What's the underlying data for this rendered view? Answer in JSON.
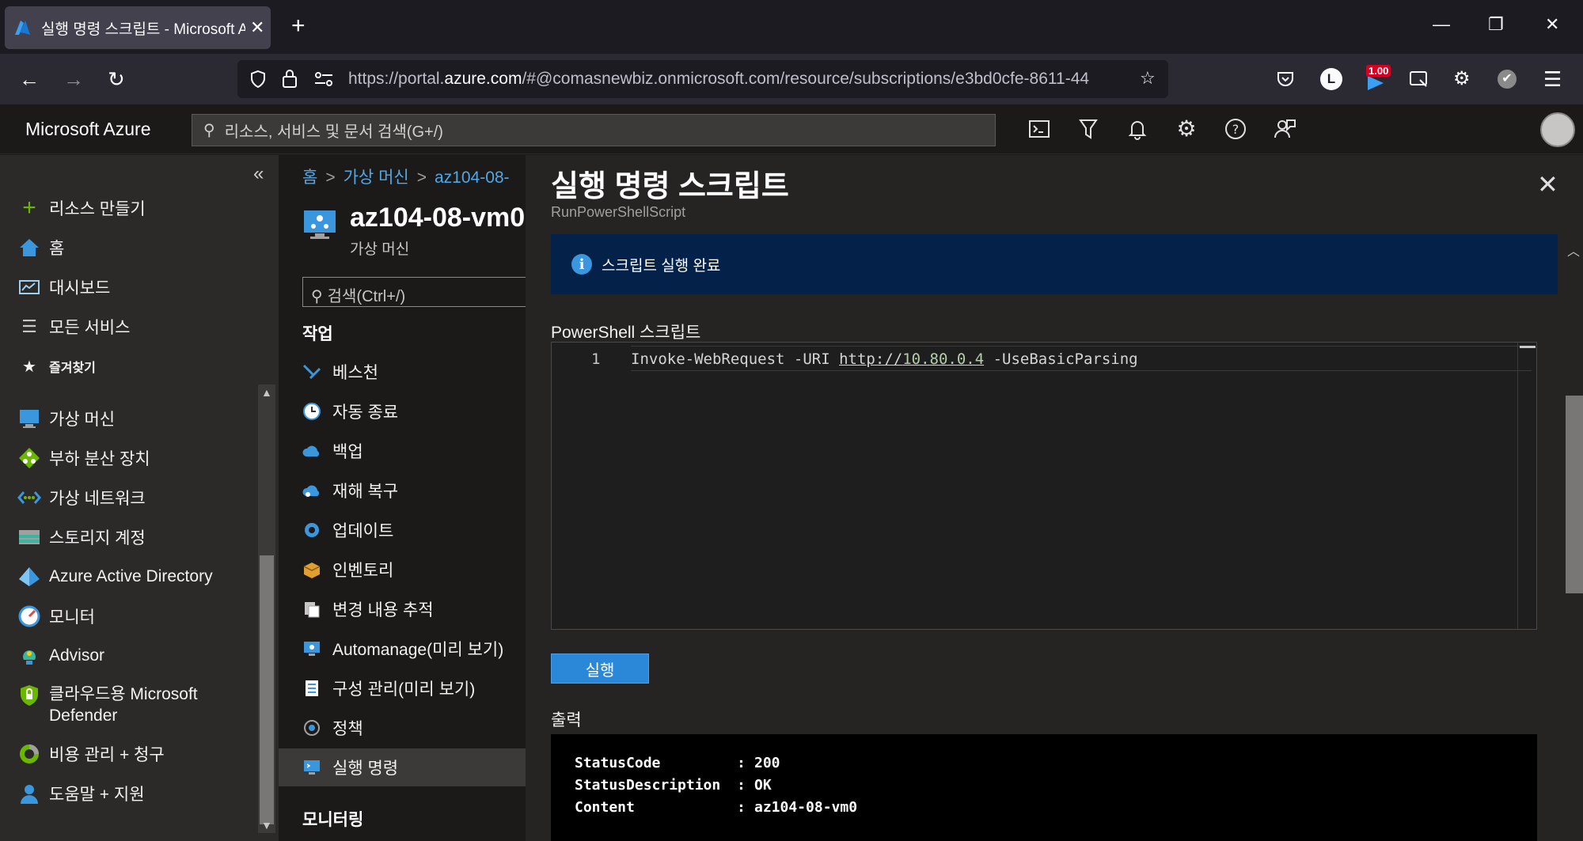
{
  "browser": {
    "tab_title": "실행 명령 스크립트 - Microsoft Azure",
    "url_prefix": "https://portal.",
    "url_domain": "azure.com",
    "url_rest": "/#@comasnewbiz.onmicrosoft.com/resource/subscriptions/e3bd0cfe-8611-44",
    "ext_badge": "1.00",
    "profile_initial": "L"
  },
  "portal": {
    "brand": "Microsoft Azure",
    "search_placeholder": "리소스, 서비스 및 문서 검색(G+/)"
  },
  "sidebar": {
    "create": "리소스 만들기",
    "home": "홈",
    "dashboard": "대시보드",
    "all_services": "모든 서비스",
    "favorites": "즐겨찾기",
    "items": [
      {
        "label": "가상 머신",
        "icon": "vm-icon"
      },
      {
        "label": "부하 분산 장치",
        "icon": "load-balancer-icon"
      },
      {
        "label": "가상 네트워크",
        "icon": "vnet-icon"
      },
      {
        "label": "스토리지 계정",
        "icon": "storage-icon"
      },
      {
        "label": "Azure Active Directory",
        "icon": "aad-icon"
      },
      {
        "label": "모니터",
        "icon": "monitor-icon"
      },
      {
        "label": "Advisor",
        "icon": "advisor-icon"
      },
      {
        "label": "클라우드용 Microsoft",
        "label2": "Defender",
        "icon": "defender-icon"
      },
      {
        "label": "비용 관리 + 청구",
        "icon": "cost-icon"
      },
      {
        "label": "도움말 + 지원",
        "icon": "help-support-icon"
      }
    ]
  },
  "blade": {
    "breadcrumb": [
      "홈",
      "가상 머신",
      "az104-08-"
    ],
    "title": "az104-08-vm0",
    "subtitle": "가상 머신",
    "search_placeholder": "검색(Ctrl+/)",
    "section_ops": "작업",
    "ops": [
      "베스천",
      "자동 종료",
      "백업",
      "재해 복구",
      "업데이트",
      "인벤토리",
      "변경 내용 추적",
      "Automanage(미리 보기)",
      "구성 관리(미리 보기)",
      "정책",
      "실행 명령"
    ],
    "section_monitoring": "모니터링"
  },
  "panel": {
    "title": "실행 명령 스크립트",
    "subtitle": "RunPowerShellScript",
    "info_message": "스크립트 실행 완료",
    "script_label": "PowerShell 스크립트",
    "line_number": "1",
    "code_part1": "Invoke-WebRequest -URI ",
    "code_url_scheme": "http://",
    "code_url_ip": "10.80.0.4",
    "code_part2": " -UseBasicParsing",
    "run_button": "실행",
    "output_label": "출력",
    "output_rows": [
      {
        "key": "StatusCode",
        "value": "200"
      },
      {
        "key": "StatusDescription",
        "value": "OK"
      },
      {
        "key": "Content",
        "value": "az104-08-vm0"
      }
    ]
  }
}
